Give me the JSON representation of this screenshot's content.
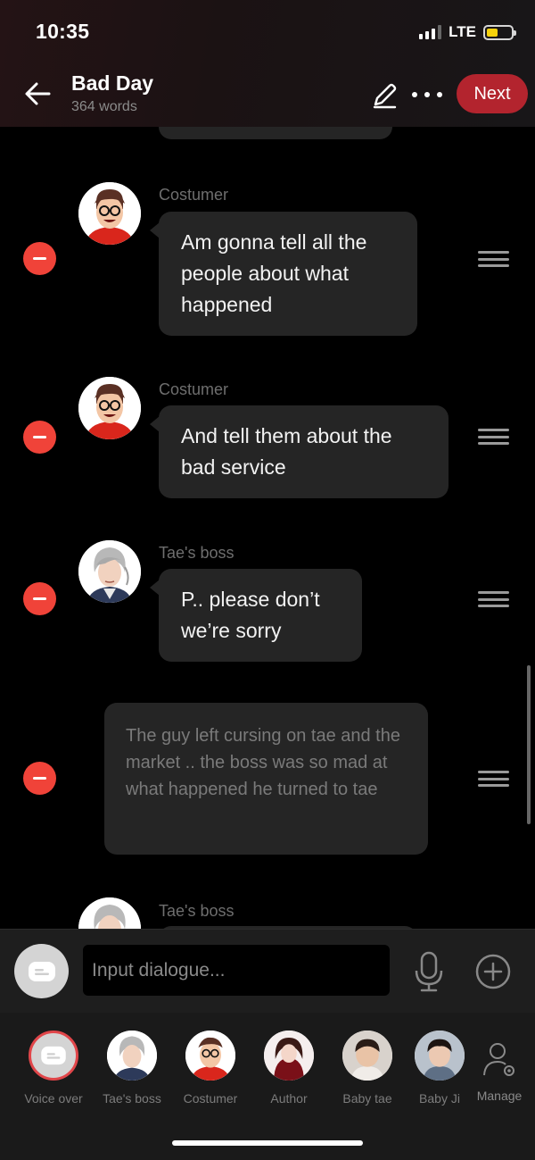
{
  "status_bar": {
    "time": "10:35",
    "network": "LTE",
    "battery_color": "#f5d10b"
  },
  "header": {
    "title": "Bad Day",
    "subtitle": "364 words",
    "next_label": "Next"
  },
  "messages": [
    {
      "speaker": "Costumer",
      "text": "Am gonna tell all the people about what happened",
      "avatar": "costumer-avatar"
    },
    {
      "speaker": "Costumer",
      "text": "And tell them about the bad service",
      "avatar": "costumer-avatar"
    },
    {
      "speaker": "Tae's boss",
      "text": "P.. please don’t we’re sorry",
      "avatar": "taes-boss-avatar"
    },
    {
      "speaker": "",
      "text": "The guy left cursing on tae and the market .. the boss was so mad at what happened he turned to tae",
      "avatar": ""
    },
    {
      "speaker": "Tae's boss",
      "text": "",
      "avatar": "taes-boss-avatar"
    }
  ],
  "input": {
    "placeholder": "Input dialogue..."
  },
  "characters": [
    {
      "name": "Voice over",
      "icon": "voice-over-icon"
    },
    {
      "name": "Tae's boss",
      "icon": "taes-boss-avatar"
    },
    {
      "name": "Costumer",
      "icon": "costumer-avatar"
    },
    {
      "name": "Author",
      "icon": "author-avatar"
    },
    {
      "name": "Baby tae",
      "icon": "baby-tae-avatar"
    },
    {
      "name": "Baby Ji",
      "icon": "baby-ji-avatar"
    }
  ],
  "manage_label": "Manage",
  "colors": {
    "accent": "#b3242e",
    "remove": "#f04339",
    "bubble": "#252525"
  }
}
